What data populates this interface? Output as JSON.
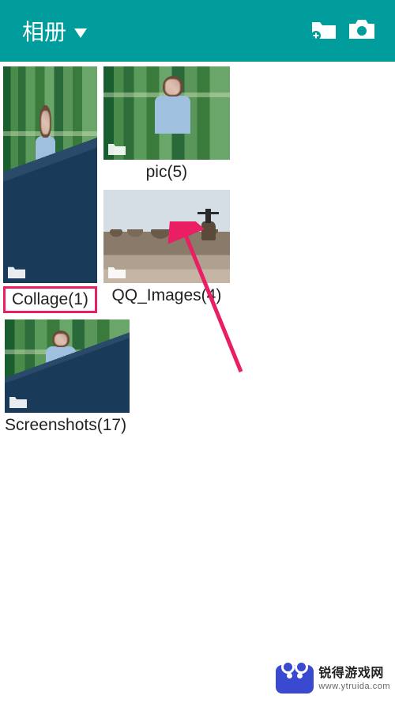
{
  "header": {
    "title": "相册",
    "dropdown_icon": "dropdown-triangle-icon",
    "new_folder_icon": "new-folder-icon",
    "camera_icon": "camera-icon"
  },
  "albums": [
    {
      "id": "collage",
      "label": "Collage(1)",
      "highlight": true
    },
    {
      "id": "pic",
      "label": "pic(5)"
    },
    {
      "id": "qq_images",
      "label": "QQ_Images(4)"
    },
    {
      "id": "screenshots",
      "label": "Screenshots(17)"
    }
  ],
  "watermark": {
    "line1": "锐得游戏网",
    "line2": "www.ytruida.com"
  }
}
